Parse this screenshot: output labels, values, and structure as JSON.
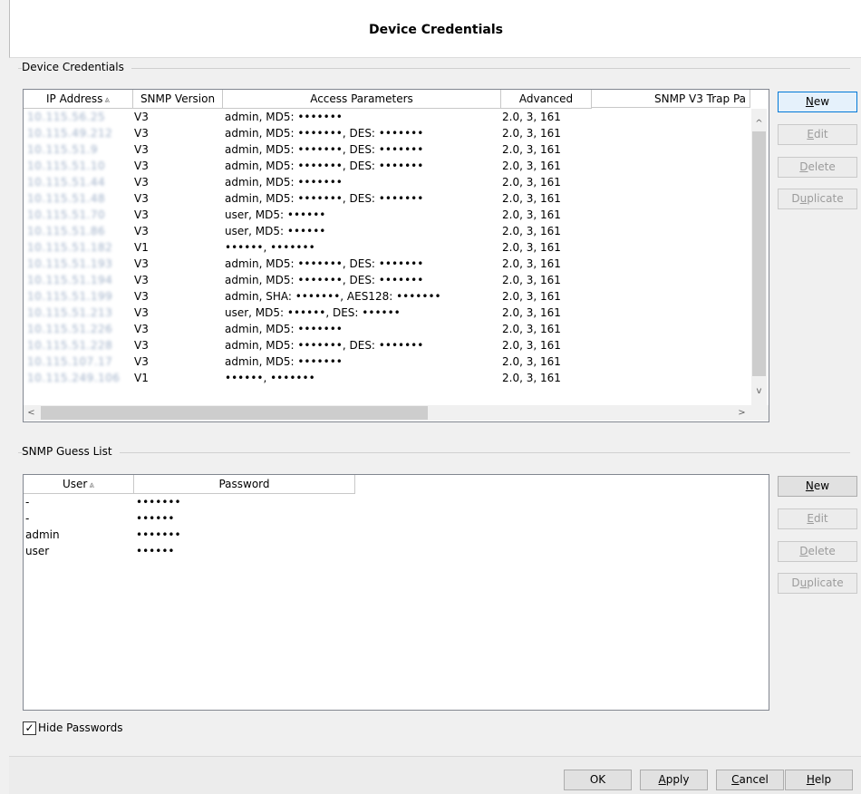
{
  "window": {
    "title": "Device Credentials"
  },
  "device_credentials": {
    "group_label": "Device Credentials",
    "columns": [
      "IP Address",
      "SNMP Version",
      "Access Parameters",
      "Advanced",
      "SNMP V3 Trap Pa"
    ],
    "sort_indicator": "⩓",
    "rows": [
      {
        "ip": "10.115.56.25",
        "version": "V3",
        "access": "admin, MD5: •••••••",
        "advanced": "2.0, 3, 161"
      },
      {
        "ip": "10.115.49.212",
        "version": "V3",
        "access": "admin, MD5: •••••••, DES: •••••••",
        "advanced": "2.0, 3, 161"
      },
      {
        "ip": "10.115.51.9",
        "version": "V3",
        "access": "admin, MD5: •••••••, DES: •••••••",
        "advanced": "2.0, 3, 161"
      },
      {
        "ip": "10.115.51.10",
        "version": "V3",
        "access": "admin, MD5: •••••••, DES: •••••••",
        "advanced": "2.0, 3, 161"
      },
      {
        "ip": "10.115.51.44",
        "version": "V3",
        "access": "admin, MD5: •••••••",
        "advanced": "2.0, 3, 161"
      },
      {
        "ip": "10.115.51.48",
        "version": "V3",
        "access": "admin, MD5: •••••••, DES: •••••••",
        "advanced": "2.0, 3, 161"
      },
      {
        "ip": "10.115.51.70",
        "version": "V3",
        "access": "user, MD5: ••••••",
        "advanced": "2.0, 3, 161"
      },
      {
        "ip": "10.115.51.86",
        "version": "V3",
        "access": "user, MD5: ••••••",
        "advanced": "2.0, 3, 161"
      },
      {
        "ip": "10.115.51.182",
        "version": "V1",
        "access": "••••••, •••••••",
        "advanced": "2.0, 3, 161"
      },
      {
        "ip": "10.115.51.193",
        "version": "V3",
        "access": "admin, MD5: •••••••, DES: •••••••",
        "advanced": "2.0, 3, 161"
      },
      {
        "ip": "10.115.51.194",
        "version": "V3",
        "access": "admin, MD5: •••••••, DES: •••••••",
        "advanced": "2.0, 3, 161"
      },
      {
        "ip": "10.115.51.199",
        "version": "V3",
        "access": "admin, SHA: •••••••, AES128: •••••••",
        "advanced": "2.0, 3, 161"
      },
      {
        "ip": "10.115.51.213",
        "version": "V3",
        "access": "user, MD5: ••••••, DES: ••••••",
        "advanced": "2.0, 3, 161"
      },
      {
        "ip": "10.115.51.226",
        "version": "V3",
        "access": "admin, MD5: •••••••",
        "advanced": "2.0, 3, 161"
      },
      {
        "ip": "10.115.51.228",
        "version": "V3",
        "access": "admin, MD5: •••••••, DES: •••••••",
        "advanced": "2.0, 3, 161"
      },
      {
        "ip": "10.115.107.17",
        "version": "V3",
        "access": "admin, MD5: •••••••",
        "advanced": "2.0, 3, 161"
      },
      {
        "ip": "10.115.249.106",
        "version": "V1",
        "access": "••••••, •••••••",
        "advanced": "2.0, 3, 161"
      }
    ],
    "buttons": {
      "new": {
        "pre": "",
        "ul": "N",
        "post": "ew"
      },
      "edit": {
        "pre": "",
        "ul": "E",
        "post": "dit"
      },
      "delete": {
        "pre": "",
        "ul": "D",
        "post": "elete"
      },
      "duplicate": {
        "pre": "D",
        "ul": "u",
        "post": "plicate"
      }
    }
  },
  "guess_list": {
    "group_label": "SNMP Guess List",
    "columns": [
      "User",
      "Password"
    ],
    "sort_indicator": "⩓",
    "rows": [
      {
        "user": "-",
        "password": "•••••••"
      },
      {
        "user": "-",
        "password": "••••••"
      },
      {
        "user": "admin",
        "password": "•••••••"
      },
      {
        "user": "user",
        "password": "••••••"
      }
    ],
    "buttons": {
      "new": {
        "pre": "",
        "ul": "N",
        "post": "ew"
      },
      "edit": {
        "pre": "",
        "ul": "E",
        "post": "dit"
      },
      "delete": {
        "pre": "",
        "ul": "D",
        "post": "elete"
      },
      "duplicate": {
        "pre": "D",
        "ul": "u",
        "post": "plicate"
      }
    }
  },
  "hide_passwords": {
    "label": "Hide Passwords",
    "checked": true,
    "mark": "✓"
  },
  "footer": {
    "ok": {
      "pre": "OK",
      "ul": "",
      "post": ""
    },
    "apply": {
      "pre": "",
      "ul": "A",
      "post": "pply"
    },
    "cancel": {
      "pre": "",
      "ul": "C",
      "post": "ancel"
    },
    "help": {
      "pre": "",
      "ul": "H",
      "post": "elp"
    }
  },
  "scroll_glyphs": {
    "up": "^",
    "down": "v",
    "left": "<",
    "right": ">"
  }
}
